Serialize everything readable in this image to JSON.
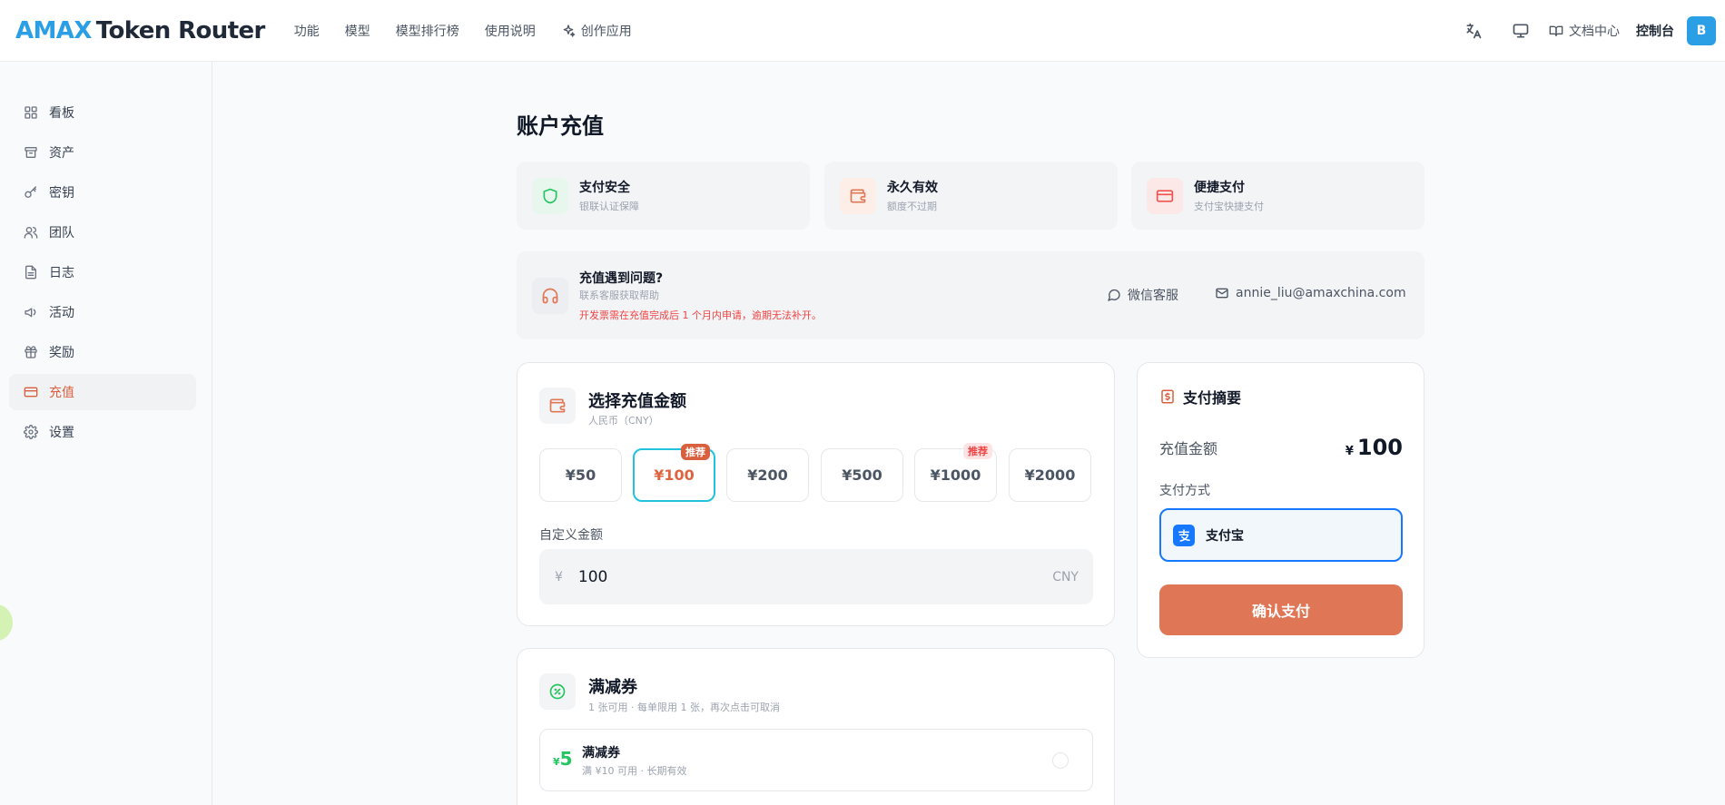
{
  "header": {
    "logo_part1": "AMAX",
    "logo_part2": "Token Router",
    "nav": [
      "功能",
      "模型",
      "模型排行榜",
      "使用说明",
      "创作应用"
    ],
    "docs_label": "文档中心",
    "console_label": "控制台",
    "avatar_initial": "B"
  },
  "sidebar": {
    "items": [
      {
        "label": "看板",
        "icon": "grid-icon"
      },
      {
        "label": "资产",
        "icon": "archive-icon"
      },
      {
        "label": "密钥",
        "icon": "key-icon"
      },
      {
        "label": "团队",
        "icon": "users-icon"
      },
      {
        "label": "日志",
        "icon": "file-icon"
      },
      {
        "label": "活动",
        "icon": "megaphone-icon"
      },
      {
        "label": "奖励",
        "icon": "gift-icon"
      },
      {
        "label": "充值",
        "icon": "credit-card-icon",
        "active": true
      },
      {
        "label": "设置",
        "icon": "gear-icon"
      }
    ]
  },
  "page": {
    "title": "账户充值"
  },
  "features": [
    {
      "title": "支付安全",
      "subtitle": "银联认证保障",
      "icon": "shield-icon",
      "color": "#22c55e"
    },
    {
      "title": "永久有效",
      "subtitle": "额度不过期",
      "icon": "wallet-icon",
      "color": "#e07755"
    },
    {
      "title": "便捷支付",
      "subtitle": "支付宝快捷支付",
      "icon": "credit-card-icon",
      "color": "#ef5350"
    }
  ],
  "help": {
    "title": "充值遇到问题?",
    "subtitle": "联系客服获取帮助",
    "warning": "开发票需在充值完成后 1 个月内申请，逾期无法补开。",
    "wechat_label": "微信客服",
    "email": "annie_liu@amaxchina.com"
  },
  "recharge": {
    "title": "选择充值金额",
    "subtitle": "人民币（CNY）",
    "amounts": [
      {
        "label": "¥50",
        "badge": ""
      },
      {
        "label": "¥100",
        "badge": "推荐",
        "selected": true
      },
      {
        "label": "¥200",
        "badge": ""
      },
      {
        "label": "¥500",
        "badge": ""
      },
      {
        "label": "¥1000",
        "badge": "推荐"
      },
      {
        "label": "¥2000",
        "badge": ""
      }
    ],
    "custom_label": "自定义金额",
    "currency_symbol": "¥",
    "custom_value": "100",
    "currency_code": "CNY"
  },
  "coupons": {
    "title": "满减券",
    "subtitle": "1 张可用 · 每单限用 1 张，再次点击可取消",
    "item": {
      "currency": "¥",
      "value": "5",
      "title": "满减券",
      "subtitle": "满 ¥10 可用 · 长期有效"
    }
  },
  "summary": {
    "title": "支付摘要",
    "amount_label": "充值金额",
    "currency_symbol": "¥",
    "amount_value": "100",
    "method_label": "支付方式",
    "method_name": "支付宝",
    "pay_button": "确认支付"
  },
  "colors": {
    "accent": "#d9603f",
    "brand_blue": "#2b9fe6",
    "selected_border": "#22c1dc",
    "alipay": "#1677ff",
    "pay_button": "#df7655"
  }
}
